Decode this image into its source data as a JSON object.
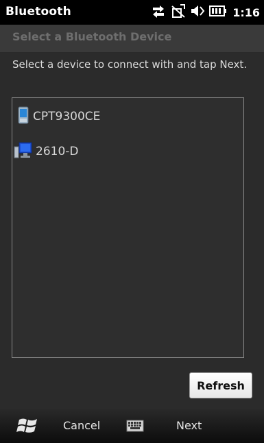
{
  "status_bar": {
    "app_title": "Bluetooth",
    "clock": "1:16",
    "icons": [
      "data-sync-icon",
      "signal-off-icon",
      "speaker-icon",
      "battery-icon"
    ]
  },
  "page": {
    "title": "Select a Bluetooth Device",
    "instruction": "Select a device to connect with and tap Next."
  },
  "devices": [
    {
      "name": "CPT9300CE",
      "icon": "pda-device-icon"
    },
    {
      "name": "2610-D",
      "icon": "computer-device-icon"
    }
  ],
  "buttons": {
    "refresh": "Refresh"
  },
  "softkeys": {
    "left": "Cancel",
    "right": "Next",
    "start_icon": "windows-start-icon",
    "keyboard_icon": "keyboard-icon"
  }
}
